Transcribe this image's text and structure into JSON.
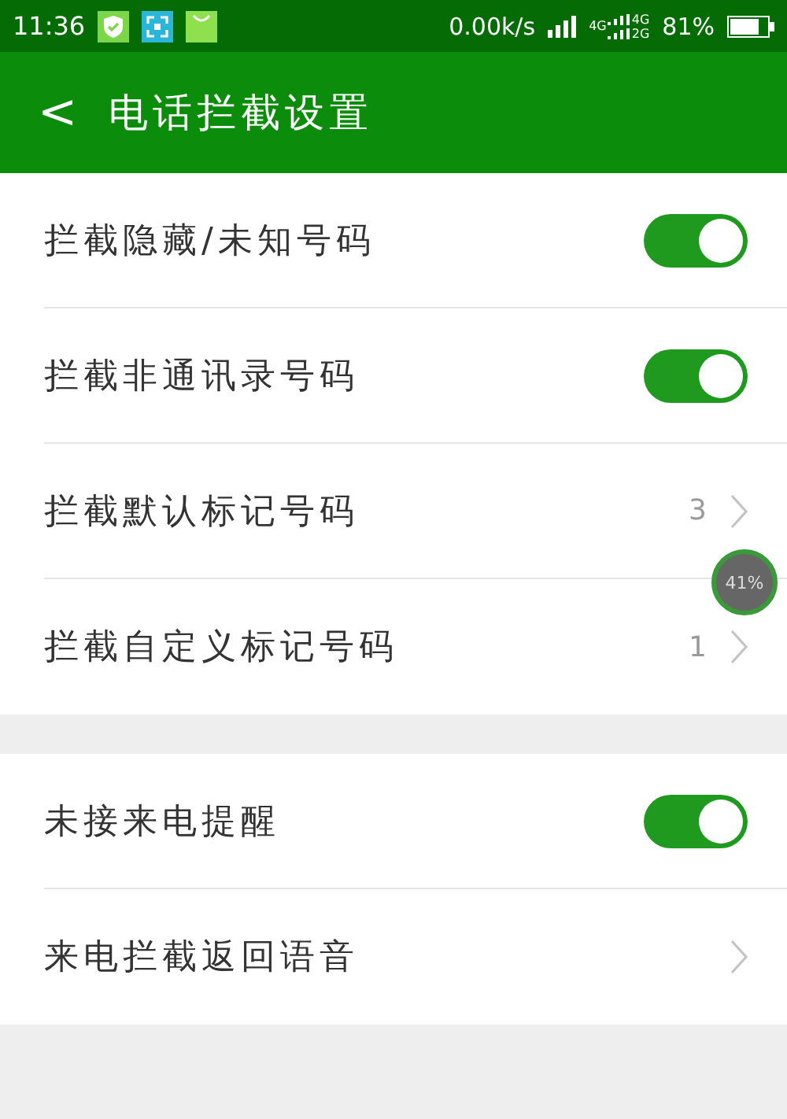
{
  "status_bar": {
    "time": "11:36",
    "speed": "0.00k/s",
    "network_labels": [
      "4G",
      "4G",
      "2G"
    ],
    "battery_text": "81%"
  },
  "header": {
    "back": "<",
    "title": "电话拦截设置"
  },
  "groups": [
    {
      "items": [
        {
          "kind": "toggle",
          "label": "拦截隐藏/未知号码",
          "on": true
        },
        {
          "kind": "toggle",
          "label": "拦截非通讯录号码",
          "on": true
        },
        {
          "kind": "link",
          "label": "拦截默认标记号码",
          "value": "3"
        },
        {
          "kind": "link",
          "label": "拦截自定义标记号码",
          "value": "1"
        }
      ]
    },
    {
      "items": [
        {
          "kind": "toggle",
          "label": "未接来电提醒",
          "on": true
        },
        {
          "kind": "link",
          "label": "来电拦截返回语音"
        }
      ]
    }
  ],
  "floating_badge": {
    "text": "41%"
  }
}
